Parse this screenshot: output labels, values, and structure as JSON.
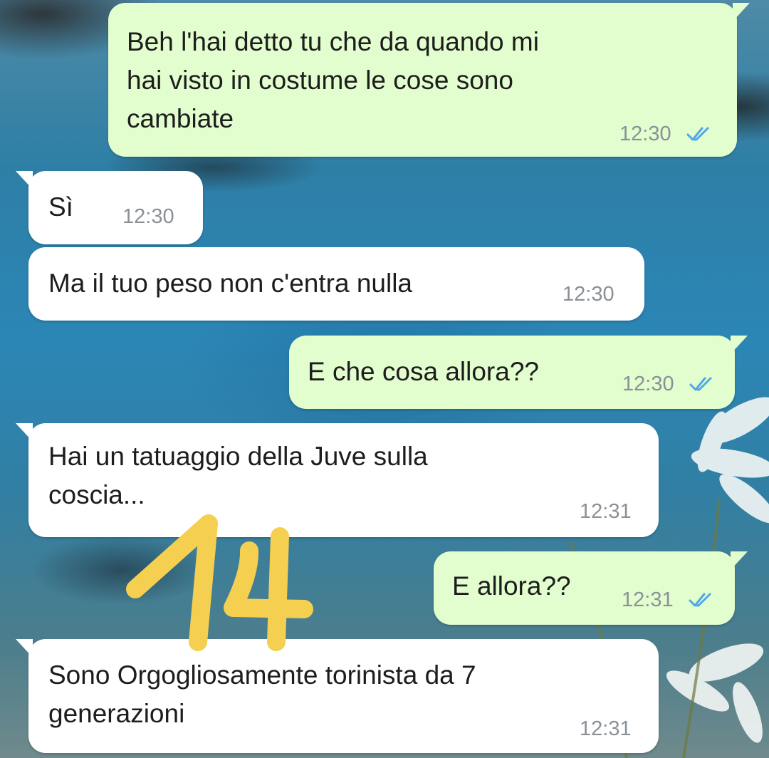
{
  "messages": [
    {
      "direction": "outgoing",
      "text": "Beh l'hai detto tu che da quando mi\nhai visto in costume le cose sono\ncambiate",
      "time": "12:30",
      "status_icon": "double-check-read-icon"
    },
    {
      "direction": "incoming",
      "text": "Sì",
      "time": "12:30"
    },
    {
      "direction": "incoming",
      "text": "Ma il tuo peso non c'entra nulla",
      "time": "12:30"
    },
    {
      "direction": "outgoing",
      "text": "E che cosa allora??",
      "time": "12:30",
      "status_icon": "double-check-read-icon"
    },
    {
      "direction": "incoming",
      "text": "Hai un tatuaggio della Juve sulla\ncoscia...",
      "time": "12:31"
    },
    {
      "direction": "outgoing",
      "text": "E allora??",
      "time": "12:31",
      "status_icon": "double-check-read-icon"
    },
    {
      "direction": "incoming",
      "text": "Sono Orgogliosamente torinista da 7\ngenerazioni",
      "time": "12:31"
    }
  ],
  "colors": {
    "outgoing_bubble": "#e2fdce",
    "incoming_bubble": "#ffffff",
    "read_tick": "#4fa6e8",
    "timestamp": "#8a9096",
    "annotation": "#f5cf50"
  },
  "annotation_mark": "14"
}
